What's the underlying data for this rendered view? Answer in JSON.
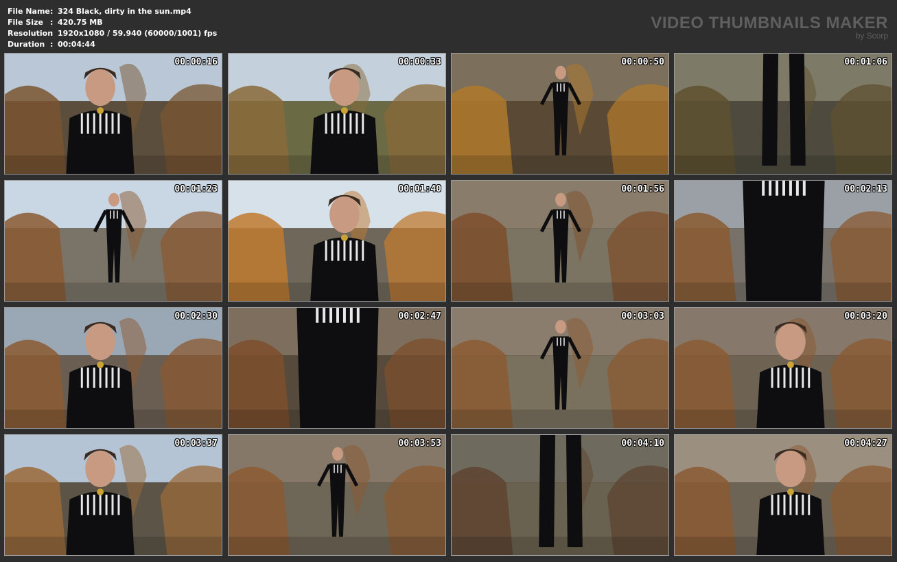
{
  "info": {
    "file_name": {
      "label": "File Name",
      "value": "324 Black, dirty in the sun.mp4"
    },
    "file_size": {
      "label": "File Size",
      "value": "420.75 MB"
    },
    "resolution": {
      "label": "Resolution",
      "value": "1920x1080 / 59.940 (60000/1001) fps"
    },
    "duration": {
      "label": "Duration",
      "value": "00:04:44"
    },
    "separator": ":"
  },
  "brand": {
    "title": "VIDEO THUMBNAILS MAKER",
    "subtitle": "by Scorp"
  },
  "colors": {
    "background": "#2e2e2e",
    "brand_text": "#5f5f5f",
    "thumb_border": "#9c9c9c"
  },
  "thumbnails": [
    {
      "timestamp": "00:00:16",
      "sky": "#b9c7d6",
      "ground": "#5b4e3c",
      "accent": "#7a5530",
      "subject": "seated"
    },
    {
      "timestamp": "00:00:33",
      "sky": "#c4d0dc",
      "ground": "#6a6a45",
      "accent": "#8a6a3a",
      "subject": "seated"
    },
    {
      "timestamp": "00:00:50",
      "sky": "#7c6f5c",
      "ground": "#5a4a35",
      "accent": "#b07a2c",
      "subject": "standing"
    },
    {
      "timestamp": "00:01:06",
      "sky": "#7e7a68",
      "ground": "#4e4a3e",
      "accent": "#5f5130",
      "subject": "boots"
    },
    {
      "timestamp": "00:01:23",
      "sky": "#c9d6e4",
      "ground": "#7a7468",
      "accent": "#8b5a32",
      "subject": "standing"
    },
    {
      "timestamp": "00:01:40",
      "sky": "#d7e1ea",
      "ground": "#6f675a",
      "accent": "#c07a30",
      "subject": "closeup"
    },
    {
      "timestamp": "00:01:56",
      "sky": "#8a7c6a",
      "ground": "#7c7462",
      "accent": "#7d4f2c",
      "subject": "standing"
    },
    {
      "timestamp": "00:02:13",
      "sky": "#9aa0a6",
      "ground": "#77716a",
      "accent": "#8a5a30",
      "subject": "body"
    },
    {
      "timestamp": "00:02:30",
      "sky": "#9aa7b5",
      "ground": "#6a5e52",
      "accent": "#8b5a32",
      "subject": "closeup"
    },
    {
      "timestamp": "00:02:47",
      "sky": "#7d6e5e",
      "ground": "#564a3c",
      "accent": "#7d4f2c",
      "subject": "body"
    },
    {
      "timestamp": "00:03:03",
      "sky": "#8a7d6e",
      "ground": "#7a705e",
      "accent": "#8b5a32",
      "subject": "standing"
    },
    {
      "timestamp": "00:03:20",
      "sky": "#86786a",
      "ground": "#6e6252",
      "accent": "#8b5a32",
      "subject": "closeup"
    },
    {
      "timestamp": "00:03:37",
      "sky": "#b4c4d4",
      "ground": "#5c5446",
      "accent": "#9a6a3a",
      "subject": "closeup"
    },
    {
      "timestamp": "00:03:53",
      "sky": "#857868",
      "ground": "#6e6656",
      "accent": "#8b5a32",
      "subject": "standing"
    },
    {
      "timestamp": "00:04:10",
      "sky": "#6e6a5e",
      "ground": "#6a6250",
      "accent": "#5e4430",
      "subject": "boots"
    },
    {
      "timestamp": "00:04:27",
      "sky": "#9b8f80",
      "ground": "#6e6456",
      "accent": "#8b5a32",
      "subject": "closeup"
    }
  ]
}
